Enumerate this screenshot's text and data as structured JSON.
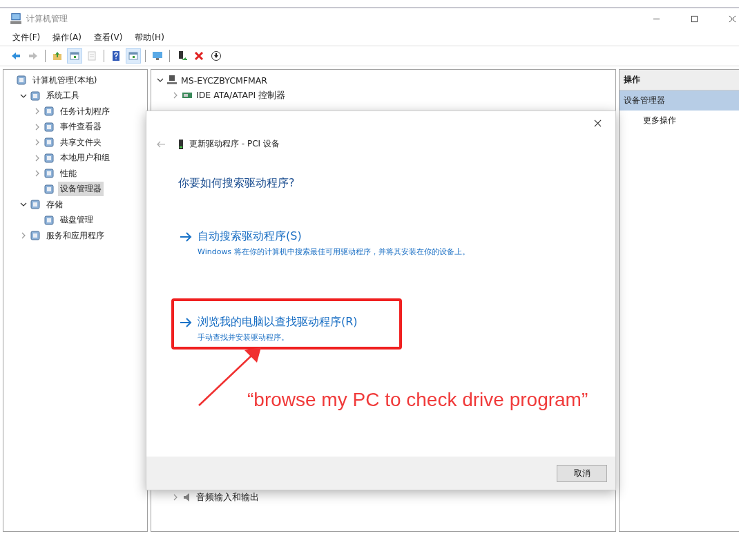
{
  "window": {
    "title": "计算机管理"
  },
  "menu": [
    "文件(F)",
    "操作(A)",
    "查看(V)",
    "帮助(H)"
  ],
  "toolbar": [
    {
      "kind": "back",
      "selected": false,
      "disabled": false
    },
    {
      "kind": "forward",
      "selected": false,
      "disabled": true
    },
    {
      "kind": "sep"
    },
    {
      "kind": "up",
      "selected": false,
      "disabled": false
    },
    {
      "kind": "tree",
      "selected": true,
      "disabled": false
    },
    {
      "kind": "export",
      "selected": false,
      "disabled": true
    },
    {
      "kind": "sep"
    },
    {
      "kind": "help",
      "selected": false,
      "disabled": false
    },
    {
      "kind": "pane",
      "selected": true,
      "disabled": false
    },
    {
      "kind": "sep"
    },
    {
      "kind": "monitor",
      "selected": false,
      "disabled": false
    },
    {
      "kind": "sep"
    },
    {
      "kind": "enable",
      "selected": false,
      "disabled": false
    },
    {
      "kind": "remove",
      "selected": false,
      "disabled": false
    },
    {
      "kind": "download",
      "selected": false,
      "disabled": false
    }
  ],
  "sidebar": {
    "tree": [
      {
        "label": "计算机管理(本地)",
        "selected": false,
        "children": [
          {
            "label": "系统工具",
            "selected": false,
            "expanded": true,
            "children": [
              {
                "label": "任务计划程序",
                "selected": false,
                "expanded": false
              },
              {
                "label": "事件查看器",
                "selected": false,
                "expanded": false
              },
              {
                "label": "共享文件夹",
                "selected": false,
                "expanded": false
              },
              {
                "label": "本地用户和组",
                "selected": false,
                "expanded": false
              },
              {
                "label": "性能",
                "selected": false,
                "expanded": false
              },
              {
                "label": "设备管理器",
                "selected": true
              }
            ]
          },
          {
            "label": "存储",
            "selected": false,
            "expanded": true,
            "children": [
              {
                "label": "磁盘管理",
                "selected": false
              }
            ]
          },
          {
            "label": "服务和应用程序",
            "selected": false,
            "expanded": false
          }
        ]
      }
    ]
  },
  "devices": {
    "root": {
      "label": "MS-EYCZBYCMFMAR",
      "expanded": true
    },
    "top_items": [
      "IDE ATA/ATAPI 控制器"
    ],
    "bottom_items": [
      "音频输入和输出"
    ]
  },
  "actions": {
    "header": "操作",
    "section": "设备管理器",
    "items": [
      "更多操作"
    ]
  },
  "dialog": {
    "title": "更新驱动程序 - PCI 设备",
    "heading": "你要如何搜索驱动程序?",
    "options": [
      {
        "title": "自动搜索驱动程序(S)",
        "description": "Windows 将在你的计算机中搜索最佳可用驱动程序，并将其安装在你的设备上。",
        "highlighted": false
      },
      {
        "title": "浏览我的电脑以查找驱动程序(R)",
        "description": "手动查找并安装驱动程序。",
        "highlighted": true
      }
    ],
    "cancel": "取消"
  },
  "annotation": {
    "caption": "“browse my PC to check drive program”"
  }
}
